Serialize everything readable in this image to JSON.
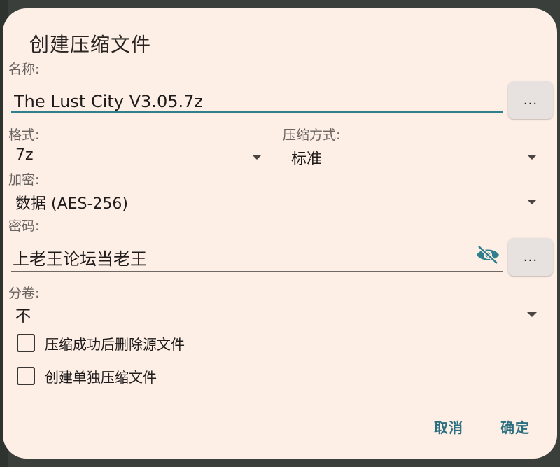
{
  "dialog": {
    "title": "创建压缩文件",
    "name_label": "名称:",
    "name_value": "The Lust City V3.05.7z",
    "browse_label": "...",
    "format_label": "格式:",
    "format_value": "7z",
    "compression_label": "压缩方式:",
    "compression_value": "标准",
    "encryption_label": "加密:",
    "encryption_value": "数据 (AES-256)",
    "password_label": "密码:",
    "password_value": "上老王论坛当老王",
    "password_browse_label": "...",
    "split_label": "分卷:",
    "split_value": "不",
    "delete_source_label": "压缩成功后删除源文件",
    "delete_source_checked": false,
    "separate_archives_label": "创建单独压缩文件",
    "separate_archives_checked": false,
    "cancel_label": "取消",
    "ok_label": "确定"
  },
  "colors": {
    "dialog_bg": "#fdeee6",
    "accent": "#2f7f8c",
    "action_text": "#2a6f80",
    "backdrop": "#3a3f3c"
  },
  "icons": {
    "password_visibility": "eye-off-icon",
    "dropdown": "caret-down-icon"
  }
}
